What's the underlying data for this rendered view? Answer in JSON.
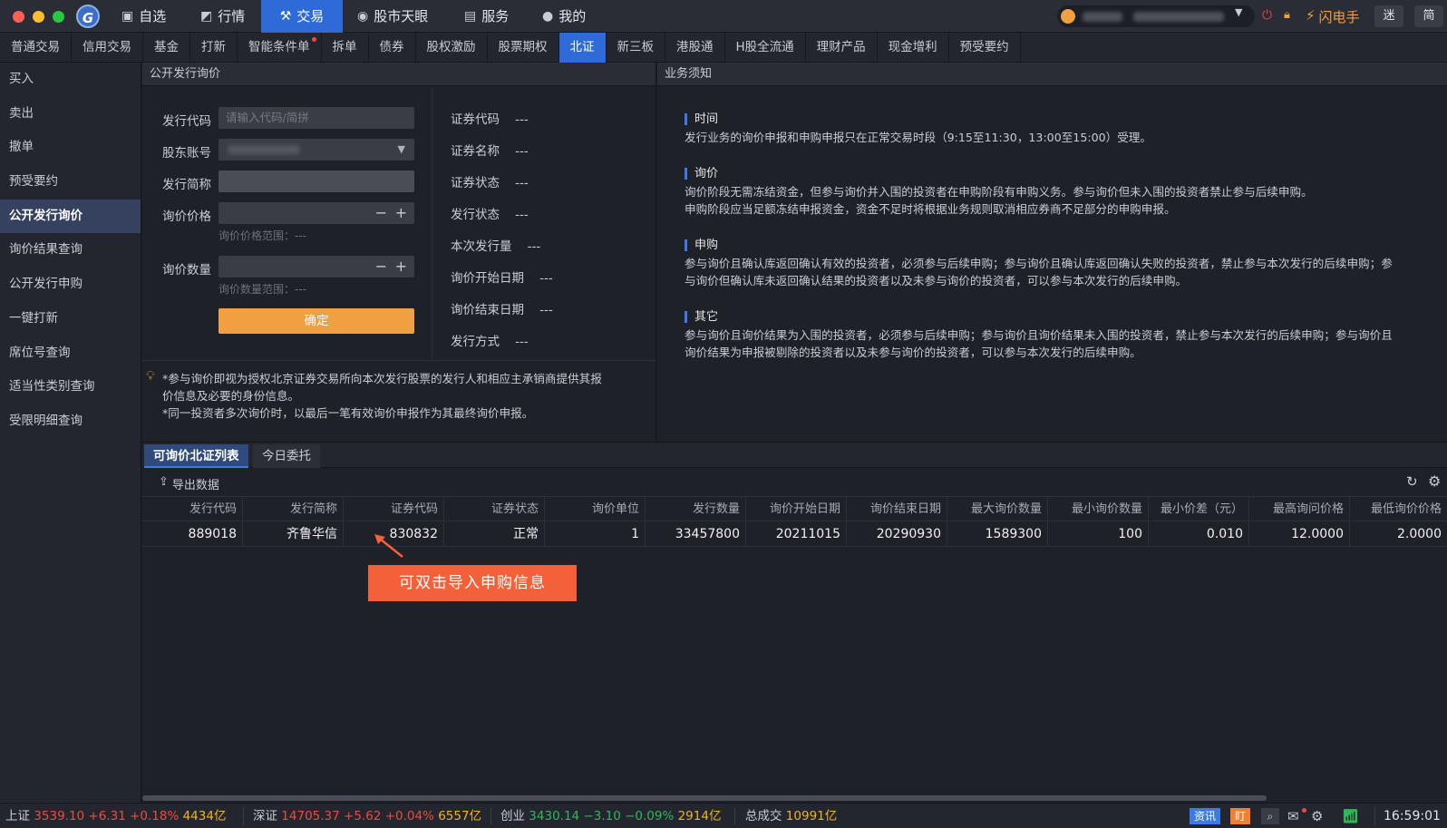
{
  "top_nav": {
    "tabs": [
      {
        "label": "自选",
        "icon": "star-square-icon"
      },
      {
        "label": "行情",
        "icon": "chart-icon"
      },
      {
        "label": "交易",
        "icon": "hammer-icon",
        "active": true
      },
      {
        "label": "股市天眼",
        "icon": "eye-icon"
      },
      {
        "label": "服务",
        "icon": "briefcase-icon"
      },
      {
        "label": "我的",
        "icon": "user-icon"
      }
    ],
    "flash_label": "闪电手",
    "btn_mini": "迷",
    "btn_simple": "简"
  },
  "sub_nav": {
    "tabs": [
      "普通交易",
      "信用交易",
      "基金",
      "打新",
      "智能条件单",
      "拆单",
      "债券",
      "股权激励",
      "股票期权",
      "北证",
      "新三板",
      "港股通",
      "H股全流通",
      "理财产品",
      "现金增利",
      "预受要约"
    ],
    "active": "北证"
  },
  "sidebar": {
    "items": [
      "买入",
      "卖出",
      "撤单",
      "预受要约",
      "公开发行询价",
      "询价结果查询",
      "公开发行申购",
      "一键打新",
      "席位号查询",
      "适当性类别查询",
      "受限明细查询"
    ],
    "active": "公开发行询价"
  },
  "form": {
    "title": "公开发行询价",
    "code_label": "发行代码",
    "code_placeholder": "请输入代码/简拼",
    "account_label": "股东账号",
    "name_label": "发行简称",
    "price_label": "询价价格",
    "price_range": "询价价格范围：---",
    "qty_label": "询价数量",
    "qty_range": "询价数量范围：---",
    "confirm": "确定",
    "minus": "−",
    "plus": "+"
  },
  "info": [
    {
      "label": "证券代码",
      "value": "---"
    },
    {
      "label": "证券名称",
      "value": "---"
    },
    {
      "label": "证券状态",
      "value": "---"
    },
    {
      "label": "发行状态",
      "value": "---"
    },
    {
      "label": "本次发行量",
      "value": "---"
    },
    {
      "label": "询价开始日期",
      "value": "---"
    },
    {
      "label": "询价结束日期",
      "value": "---"
    },
    {
      "label": "发行方式",
      "value": "---"
    }
  ],
  "disclaimer": {
    "line1": "*参与询价即视为授权北京证券交易所向本次发行股票的发行人和相应主承销商提供其报",
    "line2": "价信息及必要的身份信息。",
    "line3": "*同一投资者多次询价时，以最后一笔有效询价申报作为其最终询价申报。"
  },
  "notice": {
    "title": "业务须知",
    "sections": [
      {
        "heading": "时间",
        "lines": [
          "发行业务的询价申报和申购申报只在正常交易时段（9:15至11:30，13:00至15:00）受理。"
        ]
      },
      {
        "heading": "询价",
        "lines": [
          "询价阶段无需冻结资金，但参与询价并入围的投资者在申购阶段有申购义务。参与询价但未入围的投资者禁止参与后续申购。",
          "申购阶段应当足额冻结申报资金，资金不足时将根据业务规则取消相应券商不足部分的申购申报。"
        ]
      },
      {
        "heading": "申购",
        "lines": [
          "参与询价且确认库返回确认有效的投资者，必须参与后续申购；参与询价且确认库返回确认失败的投资者，禁止参与本次发行的后续申购；参",
          "与询价但确认库未返回确认结果的投资者以及未参与询价的投资者，可以参与本次发行的后续申购。"
        ]
      },
      {
        "heading": "其它",
        "lines": [
          "参与询价且询价结果为入围的投资者，必须参与后续申购；参与询价且询价结果未入围的投资者，禁止参与本次发行的后续申购；参与询价且",
          "询价结果为申报被剔除的投资者以及未参与询价的投资者，可以参与本次发行的后续申购。"
        ]
      }
    ]
  },
  "bottom_tabs": [
    "可询价北证列表",
    "今日委托"
  ],
  "export_label": "导出数据",
  "table": {
    "headers": [
      "发行代码",
      "发行简称",
      "证券代码",
      "证券状态",
      "询价单位",
      "发行数量",
      "询价开始日期",
      "询价结束日期",
      "最大询价数量",
      "最小询价数量",
      "最小价差（元）",
      "最高询问价格",
      "最低询价价格"
    ],
    "rows": [
      [
        "889018",
        "齐鲁华信",
        "830832",
        "正常",
        "1",
        "33457800",
        "20211015",
        "20290930",
        "1589300",
        "100",
        "0.010",
        "12.0000",
        "2.0000"
      ]
    ]
  },
  "callout": "可双击导入申购信息",
  "status_bar": {
    "sh": {
      "name": "上证",
      "price": "3539.10",
      "chg": "+6.31",
      "pct": "+0.18%",
      "amt": "4434亿"
    },
    "sz": {
      "name": "深证",
      "price": "14705.37",
      "chg": "+5.62",
      "pct": "+0.04%",
      "amt": "6557亿"
    },
    "cy": {
      "name": "创业",
      "price": "3430.14",
      "chg": "−3.10",
      "pct": "−0.09%",
      "amt": "2914亿"
    },
    "total_label": "总成交",
    "total": "10991亿",
    "news": "资讯",
    "ding": "盯",
    "time": "16:59:01"
  },
  "colors": {
    "accent": "#2f6bd8",
    "confirm": "#f0a040",
    "callout": "#f4603a",
    "up": "#f04b3a",
    "down": "#2fb85a",
    "amount": "#f2b320"
  }
}
